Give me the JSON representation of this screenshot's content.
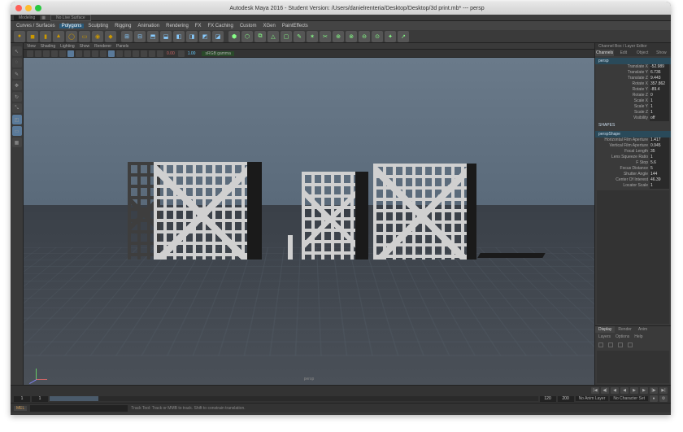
{
  "window": {
    "title": "Autodesk Maya 2016 - Student Version: /Users/danielrenteria/Desktop/Desktop/3d print.mb* --- persp"
  },
  "dropdown": {
    "value": "Modeling"
  },
  "menus": [
    "Curves / Surfaces",
    "Polygons",
    "Sculpting",
    "Rigging",
    "Animation",
    "Rendering",
    "FX",
    "FX Caching",
    "Custom",
    "XGen",
    "PaintEffects"
  ],
  "menu_selected": "Polygons",
  "ws": {
    "live": "No Live Surface"
  },
  "vpmenu": [
    "View",
    "Shading",
    "Lighting",
    "Show",
    "Renderer",
    "Panels"
  ],
  "vp": {
    "gamma": "sRGB gamma",
    "camera": "persp"
  },
  "channel": {
    "title": "Channel Box / Layer Editor",
    "tabs": [
      "Channels",
      "Edit",
      "Object",
      "Show"
    ],
    "node": "persp",
    "attrs": [
      {
        "n": "Translate X",
        "v": "-52.989"
      },
      {
        "n": "Translate Y",
        "v": "6.736"
      },
      {
        "n": "Translate Z",
        "v": "9.443"
      },
      {
        "n": "Rotate X",
        "v": "357.862"
      },
      {
        "n": "Rotate Y",
        "v": "-89.4"
      },
      {
        "n": "Rotate Z",
        "v": "0"
      },
      {
        "n": "Scale X",
        "v": "1"
      },
      {
        "n": "Scale Y",
        "v": "1"
      },
      {
        "n": "Scale Z",
        "v": "1"
      },
      {
        "n": "Visibility",
        "v": "off"
      }
    ],
    "shapes": "SHAPES",
    "shapenode": "perspShape",
    "sattrs": [
      {
        "n": "Horizontal Film Aperture",
        "v": "1.417"
      },
      {
        "n": "Vertical Film Aperture",
        "v": "0.945"
      },
      {
        "n": "Focal Length",
        "v": "35"
      },
      {
        "n": "Lens Squeeze Ratio",
        "v": "1"
      },
      {
        "n": "F Stop",
        "v": "5.6"
      },
      {
        "n": "Focus Distance",
        "v": "5"
      },
      {
        "n": "Shutter Angle",
        "v": "144"
      },
      {
        "n": "Center Of Interest",
        "v": "46.39"
      },
      {
        "n": "Locator Scale",
        "v": "1"
      }
    ],
    "btabs": [
      "Display",
      "Render",
      "Anim"
    ],
    "brow": [
      "Layers",
      "Options",
      "Help"
    ]
  },
  "timeline": {
    "start": "1",
    "sinner": "1",
    "einner": "120",
    "end": "200",
    "animlayer": "No Anim Layer",
    "charset": "No Character Set"
  },
  "cmd": {
    "mode": "MEL",
    "hint": "Track Tool: Track or MMB to track. Shift to constrain translation."
  }
}
